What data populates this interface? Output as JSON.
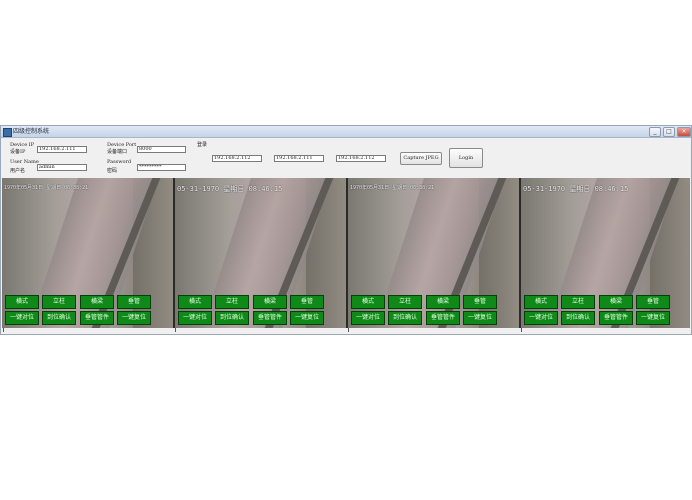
{
  "window": {
    "title": "四级控制系统",
    "buttons": [
      "_",
      "□",
      "×"
    ]
  },
  "fields": {
    "device_ip_label": "Device IP",
    "device_ip_label_cn": "设备IP",
    "device_ip_value": "192.168.2.111",
    "device_port_label": "Device Port",
    "device_port_label_cn": "设备端口",
    "device_port_value": "8000",
    "user_label": "User Name",
    "user_label_cn": "用户名",
    "user_value": "admin",
    "password_label": "Password",
    "password_label_cn": "密码",
    "password_value": "*********",
    "login_label_cn": "登录"
  },
  "ip_boxes": [
    "192.168.2.112",
    "192.168.2.111",
    "192.168.2.112"
  ],
  "toolbar": {
    "capture_label": "Capture JPEG",
    "login_label": "Login"
  },
  "cameras": [
    {
      "osd": "1970年05月31日 星期日 06:38:21",
      "buttons": [
        "横式",
        "立柱",
        "横梁",
        "垂管",
        "一键对位",
        "到位确认",
        "垂管管件",
        "一键复位"
      ]
    },
    {
      "osd": "05-31-1970 星期日 08:46:15",
      "buttons": [
        "横式",
        "立柱",
        "横梁",
        "垂管",
        "一键对位",
        "到位确认",
        "垂管管件",
        "一键复位"
      ]
    },
    {
      "osd": "1970年05月31日 星期日 06:38:21",
      "buttons": [
        "横式",
        "立柱",
        "横梁",
        "垂管",
        "一键对位",
        "到位确认",
        "垂管管件",
        "一键复位"
      ]
    },
    {
      "osd": "05-31-1970 星期日 08:46:15",
      "buttons": [
        "横式",
        "立柱",
        "横梁",
        "垂管",
        "一键对位",
        "到位确认",
        "垂管管件",
        "一键复位"
      ]
    }
  ],
  "colors": {
    "control_button": "#0f8a18",
    "titlebar": "#c5d4e8"
  }
}
